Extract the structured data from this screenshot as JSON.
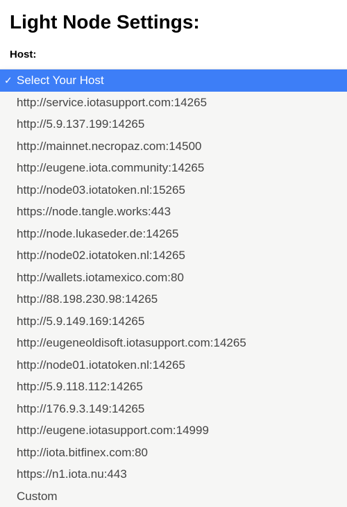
{
  "title": "Light Node Settings:",
  "hostLabel": "Host:",
  "dropdown": {
    "placeholder": "Select Your Host",
    "checkmark": "✓",
    "options": [
      "http://service.iotasupport.com:14265",
      "http://5.9.137.199:14265",
      "http://mainnet.necropaz.com:14500",
      "http://eugene.iota.community:14265",
      "http://node03.iotatoken.nl:15265",
      "https://node.tangle.works:443",
      "http://node.lukaseder.de:14265",
      "http://node02.iotatoken.nl:14265",
      "http://wallets.iotamexico.com:80",
      "http://88.198.230.98:14265",
      "http://5.9.149.169:14265",
      "http://eugeneoldisoft.iotasupport.com:14265",
      "http://node01.iotatoken.nl:14265",
      "http://5.9.118.112:14265",
      "http://176.9.3.149:14265",
      "http://eugene.iotasupport.com:14999",
      "http://iota.bitfinex.com:80",
      "https://n1.iota.nu:443",
      "Custom"
    ]
  }
}
